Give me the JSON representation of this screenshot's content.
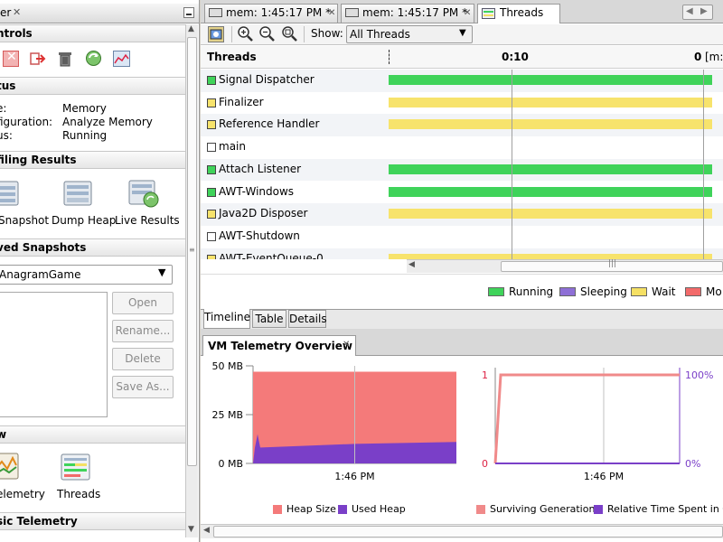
{
  "left_panel": {
    "tab_title": "er",
    "sections": {
      "controls": "ntrols",
      "status": "tus",
      "profiling_results": "filing Results",
      "saved_snapshots": "ved Snapshots",
      "view": "w",
      "basic_telemetry": "sic Telemetry"
    },
    "status": {
      "type_label": "e:",
      "type_value": "Memory",
      "config_label": "figuration:",
      "config_value": "Analyze Memory",
      "state_label": "us:",
      "state_value": "Running"
    },
    "results_buttons": {
      "snapshot": "Snapshot",
      "dump_heap": "Dump Heap",
      "live_results": "Live Results"
    },
    "snapshots_combo": "AnagramGame",
    "snapshot_buttons": {
      "open": "Open",
      "rename": "Rename...",
      "delete": "Delete",
      "save_as": "Save As..."
    },
    "view_buttons": {
      "telemetry": "elemetry",
      "threads": "Threads"
    }
  },
  "editor_tabs": [
    {
      "label": "mem: 1:45:17 PM *"
    },
    {
      "label": "mem: 1:45:17 PM *"
    },
    {
      "label": "Threads"
    }
  ],
  "toolbar": {
    "show_label": "Show:",
    "show_value": "All Threads"
  },
  "threads_view": {
    "header_label": "Threads",
    "time_tick_1": "0:10",
    "time_tick_2": "0",
    "time_unit": "[m:s]",
    "threads": [
      {
        "name": "Signal Dispatcher",
        "state": "running"
      },
      {
        "name": "Finalizer",
        "state": "wait"
      },
      {
        "name": "Reference Handler",
        "state": "wait"
      },
      {
        "name": "main",
        "state": "none"
      },
      {
        "name": "Attach Listener",
        "state": "running"
      },
      {
        "name": "AWT-Windows",
        "state": "running"
      },
      {
        "name": "Java2D Disposer",
        "state": "wait"
      },
      {
        "name": "AWT-Shutdown",
        "state": "none"
      },
      {
        "name": "AWT-EventQueue-0",
        "state": "wait"
      }
    ],
    "legend": [
      {
        "label": "Running",
        "color": "#3fd35a"
      },
      {
        "label": "Sleeping",
        "color": "#8e6fd6"
      },
      {
        "label": "Wait",
        "color": "#f5e064"
      },
      {
        "label": "Monitor",
        "color": "#f26a6a"
      }
    ],
    "legend_visible_last": "Mo",
    "bottom_tabs": [
      "Timeline",
      "Table",
      "Details"
    ]
  },
  "colors": {
    "running": "#3fd35a",
    "wait": "#f7e36c",
    "heap_size": "#f47a7a",
    "used_heap": "#7a3fc8",
    "surviving": "#f08a8a",
    "relative_gc": "#7a3fc8"
  },
  "telemetry": {
    "title": "VM Telemetry Overview",
    "heap_chart": {
      "y_ticks": [
        "50 MB",
        "25 MB",
        "0 MB"
      ],
      "x_label": "1:46 PM",
      "legend": [
        "Heap Size",
        "Used Heap"
      ]
    },
    "gen_chart": {
      "y_left_ticks": [
        "1",
        "0"
      ],
      "y_right_ticks": [
        "100%",
        "0%"
      ],
      "x_label": "1:46 PM",
      "legend": [
        "Surviving Generations",
        "Relative Time Spent in GC"
      ]
    }
  },
  "chart_data": [
    {
      "type": "area",
      "series": [
        {
          "name": "Heap Size",
          "values": [
            47,
            47,
            47
          ]
        },
        {
          "name": "Used Heap",
          "values": [
            8,
            10,
            11
          ]
        }
      ],
      "x": [
        "",
        "1:46 PM",
        ""
      ],
      "ylim": [
        0,
        50
      ]
    },
    {
      "type": "line",
      "series": [
        {
          "name": "Surviving Generations",
          "values": [
            0,
            1,
            1,
            1
          ]
        },
        {
          "name": "Relative Time Spent in GC",
          "values": [
            0,
            0,
            0,
            0
          ]
        }
      ],
      "x": [
        "",
        "",
        "1:46 PM",
        ""
      ],
      "ylim": [
        0,
        1
      ]
    }
  ]
}
